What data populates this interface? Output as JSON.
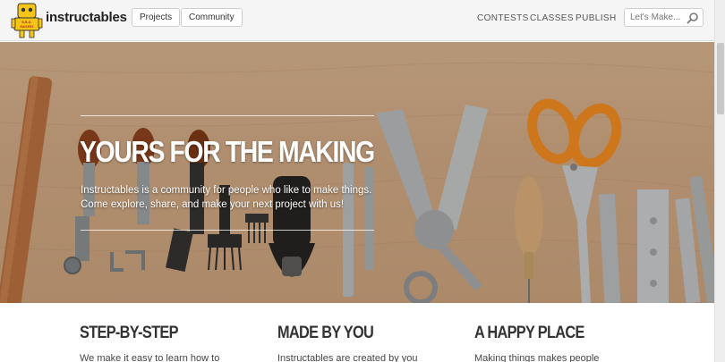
{
  "header": {
    "brand": "instructables",
    "logo_badge": "B.B.Q. RAISERS",
    "nav_buttons": [
      "Projects",
      "Community"
    ],
    "links": [
      "CONTESTS",
      "CLASSES",
      "PUBLISH"
    ],
    "search_placeholder": "Let's Make...",
    "search_icon": "search-icon"
  },
  "hero": {
    "title": "YOURS FOR THE MAKING",
    "text_line1": "Instructables is a community for people who like to make things.",
    "text_line2": "Come explore, share, and make your next project with us!"
  },
  "features": [
    {
      "title": "STEP-BY-STEP",
      "text": "We make it easy to learn how to"
    },
    {
      "title": "MADE BY YOU",
      "text": "Instructables are created by you"
    },
    {
      "title": "A HAPPY PLACE",
      "text": "Making things makes people"
    }
  ],
  "colors": {
    "accent_scissors": "#f28a1e",
    "wood": "#cfa985",
    "text": "#333333"
  }
}
